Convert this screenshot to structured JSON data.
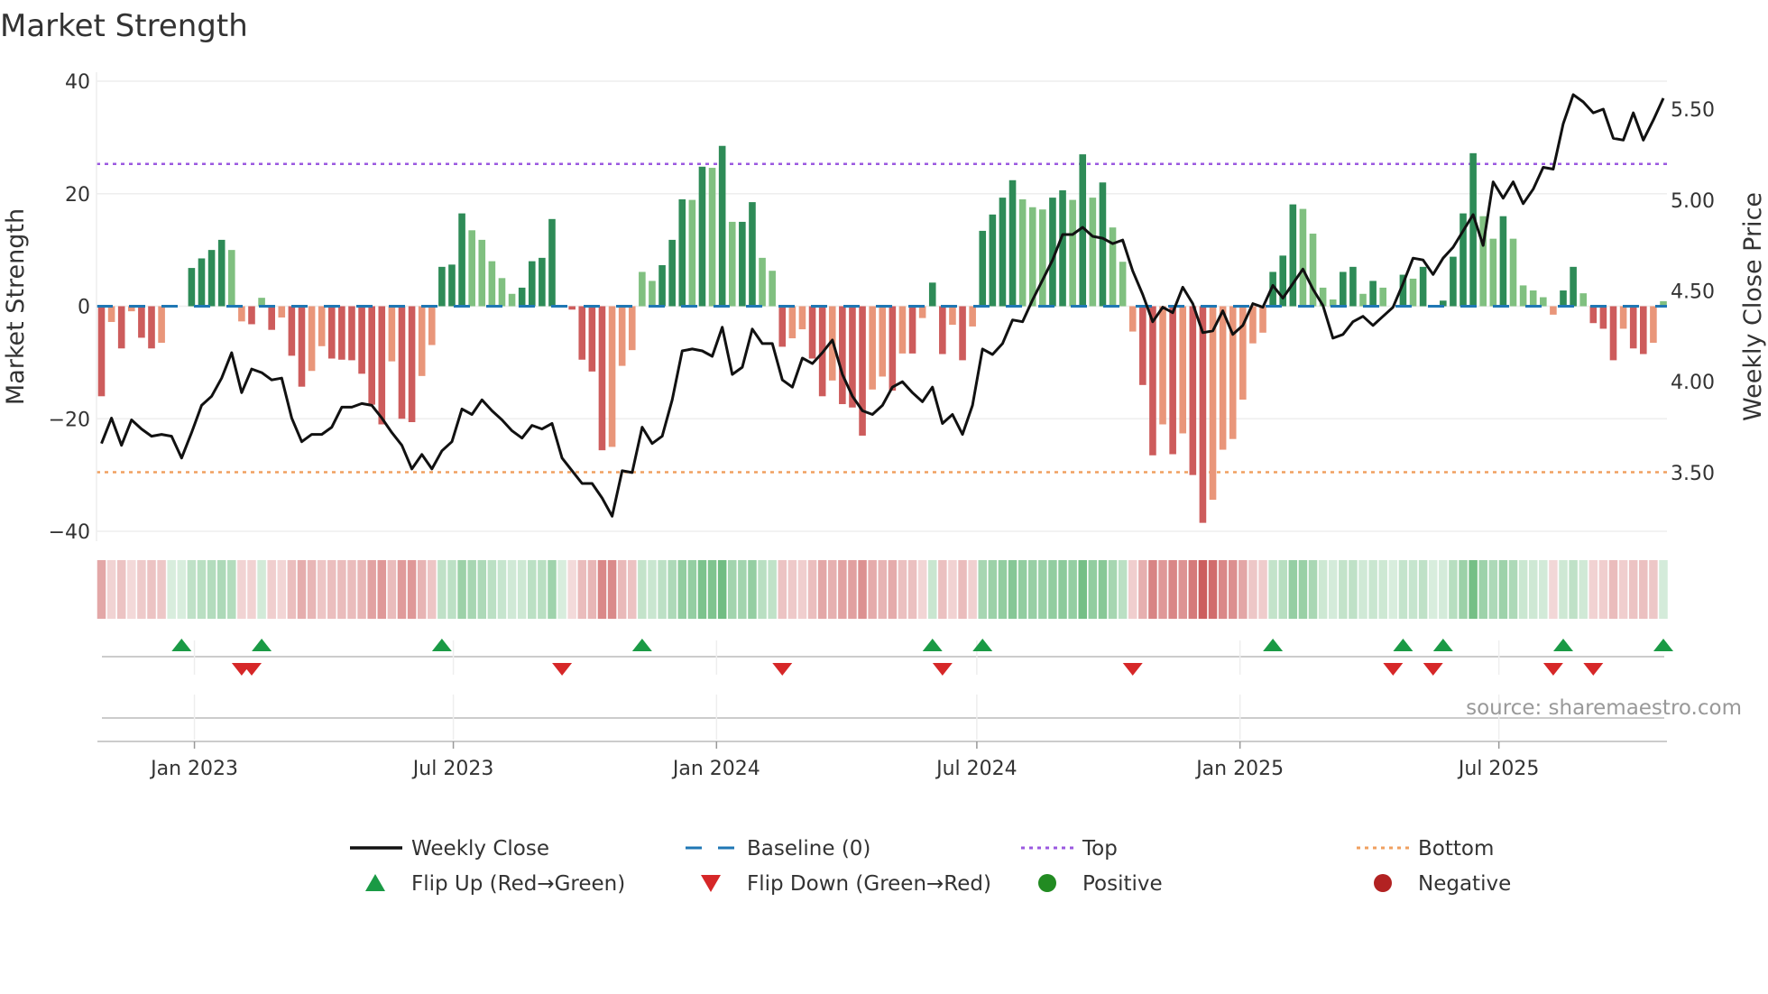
{
  "chart_data": {
    "type": "bar",
    "title": "Market Strength",
    "ylabel": "Market Strength",
    "ylabel_right": "Weekly Close Price",
    "ylim": [
      -40,
      40
    ],
    "ylim_right": [
      3.177,
      5.654
    ],
    "yticks": [
      40,
      20,
      0,
      -20,
      -40
    ],
    "yticks_labels": [
      "40",
      "20",
      "0",
      "−20",
      "−40"
    ],
    "yticks_right": [
      5.5,
      5.0,
      4.5,
      4.0,
      3.5
    ],
    "yticks_right_labels": [
      "5.50",
      "5.00",
      "4.50",
      "4.00",
      "3.50"
    ],
    "x_start": "2022-10-28",
    "x_frequency": "weekly",
    "xticks": [
      {
        "date": "2023-01-01",
        "label": "Jan 2023"
      },
      {
        "date": "2023-07-01",
        "label": "Jul 2023"
      },
      {
        "date": "2024-01-01",
        "label": "Jan 2024"
      },
      {
        "date": "2024-07-01",
        "label": "Jul 2024"
      },
      {
        "date": "2025-01-01",
        "label": "Jan 2025"
      },
      {
        "date": "2025-07-01",
        "label": "Jul 2025"
      }
    ],
    "top_level": 25.3,
    "bottom_level": -29.5,
    "baseline": 0,
    "grid": true,
    "series": [
      {
        "name": "Market Strength",
        "values": [
          -16,
          -2.8,
          -7.5,
          -0.9,
          -5.6,
          -7.5,
          -6.5,
          0,
          0,
          6.8,
          8.5,
          10,
          11.8,
          10,
          -2.7,
          -3.2,
          1.5,
          -4.2,
          -2.0,
          -8.8,
          -14.3,
          -11.5,
          -7.1,
          -9.3,
          -9.5,
          -9.6,
          -12,
          -17.5,
          -21,
          -9.8,
          -20,
          -20.6,
          -12.4,
          -6.9,
          7,
          7.4,
          16.5,
          13.5,
          11.8,
          8,
          5,
          2.2,
          3.3,
          8,
          8.6,
          15.5,
          0,
          -0.6,
          -9.5,
          -11.6,
          -25.6,
          -25,
          -10.6,
          -7.8,
          6.1,
          4.5,
          7.3,
          11.8,
          19,
          18.9,
          24.8,
          24.6,
          28.5,
          15,
          15,
          18.5,
          8.6,
          6.3,
          -7.2,
          -5.7,
          -4.1,
          -9.3,
          -16,
          -13.2,
          -17.4,
          -18,
          -23,
          -14.8,
          -12.5,
          -15,
          -8.4,
          -8.4,
          -2.1,
          4.2,
          -8.5,
          -3.3,
          -9.6,
          -3.6,
          13.4,
          16.3,
          19.3,
          22.4,
          19,
          17.6,
          17.2,
          19.3,
          20.6,
          18.9,
          27,
          19.3,
          22,
          14,
          7.9,
          -4.5,
          -14,
          -26.5,
          -21,
          -26.3,
          -22.6,
          -30,
          -38.5,
          -34.4,
          -25.5,
          -23.6,
          -16.6,
          -6.6,
          -4.7,
          6.1,
          9,
          18.1,
          17.3,
          12.9,
          3.3,
          1.2,
          6.1,
          7,
          2.2,
          4.5,
          3.3,
          0,
          5.6,
          4.9,
          7,
          0,
          1.0,
          8.8,
          16.5,
          27.2,
          16,
          12,
          16,
          12,
          3.7,
          2.8,
          1.6,
          -1.5,
          2.8,
          7,
          2.3,
          -3,
          -4,
          -9.6,
          -4,
          -7.5,
          -8.5,
          -6.5,
          0.9
        ]
      },
      {
        "name": "Weekly Close",
        "values": [
          3.66,
          3.8,
          3.65,
          3.79,
          3.74,
          3.7,
          3.71,
          3.7,
          3.58,
          3.72,
          3.87,
          3.92,
          4.02,
          4.16,
          3.94,
          4.07,
          4.05,
          4.01,
          4.02,
          3.8,
          3.67,
          3.71,
          3.71,
          3.75,
          3.86,
          3.86,
          3.88,
          3.87,
          3.8,
          3.72,
          3.65,
          3.52,
          3.6,
          3.52,
          3.62,
          3.67,
          3.85,
          3.82,
          3.9,
          3.84,
          3.79,
          3.73,
          3.69,
          3.76,
          3.74,
          3.77,
          3.58,
          3.51,
          3.44,
          3.44,
          3.36,
          3.26,
          3.51,
          3.5,
          3.75,
          3.66,
          3.7,
          3.9,
          4.17,
          4.18,
          4.17,
          4.14,
          4.3,
          4.04,
          4.08,
          4.29,
          4.21,
          4.21,
          4.01,
          3.97,
          4.13,
          4.1,
          4.16,
          4.23,
          4.04,
          3.92,
          3.84,
          3.82,
          3.87,
          3.97,
          4.0,
          3.94,
          3.89,
          3.97,
          3.77,
          3.82,
          3.71,
          3.87,
          4.18,
          4.15,
          4.21,
          4.34,
          4.33,
          4.45,
          4.56,
          4.67,
          4.81,
          4.81,
          4.85,
          4.8,
          4.79,
          4.76,
          4.78,
          4.61,
          4.48,
          4.33,
          4.41,
          4.38,
          4.52,
          4.43,
          4.27,
          4.28,
          4.39,
          4.26,
          4.31,
          4.43,
          4.41,
          4.53,
          4.46,
          4.54,
          4.62,
          4.51,
          4.42,
          4.24,
          4.26,
          4.33,
          4.36,
          4.31,
          4.36,
          4.41,
          4.54,
          4.68,
          4.67,
          4.59,
          4.68,
          4.74,
          4.83,
          4.92,
          4.75,
          5.1,
          5.01,
          5.1,
          4.98,
          5.06,
          5.18,
          5.17,
          5.42,
          5.58,
          5.54,
          5.48,
          5.5,
          5.34,
          5.33,
          5.48,
          5.33,
          5.44,
          5.56
        ]
      }
    ],
    "flip_up_weeks": [
      8,
      16,
      34,
      54,
      83,
      88,
      117,
      130,
      134,
      146,
      156
    ],
    "flip_down_weeks": [
      14,
      15,
      46,
      68,
      84,
      103,
      129,
      133,
      145,
      149
    ],
    "legend": {
      "placement": "bottom",
      "items": [
        {
          "label": "Weekly Close",
          "symbol": "line"
        },
        {
          "label": "Baseline (0)",
          "symbol": "dash"
        },
        {
          "label": "Top",
          "symbol": "dot"
        },
        {
          "label": "Bottom",
          "symbol": "dot"
        },
        {
          "label": "Flip Up (Red→Green)",
          "symbol": "triangle-up"
        },
        {
          "label": "Flip Down (Green→Red)",
          "symbol": "triangle-down"
        },
        {
          "label": "Positive",
          "symbol": "circle"
        },
        {
          "label": "Negative",
          "symbol": "circle"
        }
      ]
    },
    "annotation": "source: sharemaestro.com",
    "colors": {
      "pos_strong": "#2e8b57",
      "pos_weak": "#80c080",
      "neg_strong": "#cd5c5c",
      "neg_weak": "#e9967a",
      "line": "#111111",
      "baseline": "#1f77b4",
      "top": "#9b59e0",
      "bottom": "#f0a060",
      "flip_up": "#1a9a45",
      "flip_down": "#d62728",
      "positive": "#228b22",
      "negative": "#b22222"
    }
  }
}
